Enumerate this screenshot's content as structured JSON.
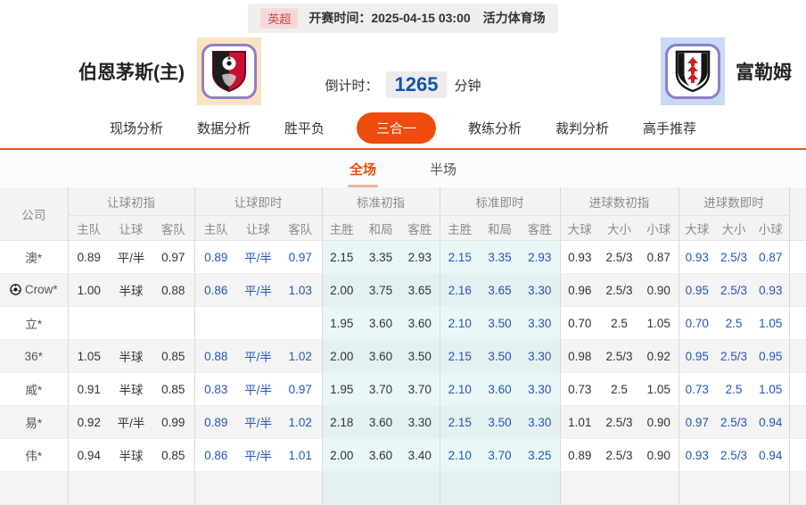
{
  "colors": {
    "accent_orange": "#ee4b0c",
    "nav_border_orange": "#e8552a",
    "blue_odds": "#2357b5",
    "league_red": "#d94141",
    "countdown_blue": "#1553ae",
    "cyan_column_bg": "#e9f7f7",
    "home_badge_bg": "#fbe3c1",
    "away_badge_bg": "#c9d9f6",
    "badge_border_purple": "#8f7fc4"
  },
  "match_bar": {
    "league": "英超",
    "kickoff_label": "开赛时间：",
    "kickoff_time": "2025-04-15 03:00",
    "venue": "活力体育场"
  },
  "teams": {
    "home": {
      "name": "伯恩茅斯(主)",
      "badge_icon": "bournemouth-crest"
    },
    "away": {
      "name": "富勒姆",
      "badge_icon": "fulham-crest"
    }
  },
  "countdown": {
    "label": "倒计时：",
    "value": "1265",
    "unit": "分钟"
  },
  "nav": {
    "items": [
      {
        "label": "现场分析",
        "active": false
      },
      {
        "label": "数据分析",
        "active": false
      },
      {
        "label": "胜平负",
        "active": false
      },
      {
        "label": "三合一",
        "active": true
      },
      {
        "label": "教练分析",
        "active": false
      },
      {
        "label": "裁判分析",
        "active": false
      },
      {
        "label": "高手推荐",
        "active": false
      }
    ]
  },
  "subtabs": {
    "items": [
      {
        "label": "全场",
        "active": true
      },
      {
        "label": "半场",
        "active": false
      }
    ]
  },
  "table": {
    "company_header": "公司",
    "groups": [
      {
        "label": "让球初指",
        "cols": [
          "主队",
          "让球",
          "客队"
        ],
        "blue": false,
        "cyan": false
      },
      {
        "label": "让球即时",
        "cols": [
          "主队",
          "让球",
          "客队"
        ],
        "blue": true,
        "cyan": false
      },
      {
        "label": "标准初指",
        "cols": [
          "主胜",
          "和局",
          "客胜"
        ],
        "blue": false,
        "cyan": true
      },
      {
        "label": "标准即时",
        "cols": [
          "主胜",
          "和局",
          "客胜"
        ],
        "blue": true,
        "cyan": true
      },
      {
        "label": "进球数初指",
        "cols": [
          "大球",
          "大小",
          "小球"
        ],
        "blue": false,
        "cyan": false
      },
      {
        "label": "进球数即时",
        "cols": [
          "大球",
          "大小",
          "小球"
        ],
        "blue": true,
        "cyan": false
      }
    ],
    "rows": [
      {
        "company": "澳*",
        "icon": false,
        "values": [
          [
            "0.89",
            "平/半",
            "0.97"
          ],
          [
            "0.89",
            "平/半",
            "0.97"
          ],
          [
            "2.15",
            "3.35",
            "2.93"
          ],
          [
            "2.15",
            "3.35",
            "2.93"
          ],
          [
            "0.93",
            "2.5/3",
            "0.87"
          ],
          [
            "0.93",
            "2.5/3",
            "0.87"
          ]
        ]
      },
      {
        "company": "Crow*",
        "icon": true,
        "values": [
          [
            "1.00",
            "半球",
            "0.88"
          ],
          [
            "0.86",
            "平/半",
            "1.03"
          ],
          [
            "2.00",
            "3.75",
            "3.65"
          ],
          [
            "2.16",
            "3.65",
            "3.30"
          ],
          [
            "0.96",
            "2.5/3",
            "0.90"
          ],
          [
            "0.95",
            "2.5/3",
            "0.93"
          ]
        ]
      },
      {
        "company": "立*",
        "icon": false,
        "values": [
          [
            "",
            "",
            ""
          ],
          [
            "",
            "",
            ""
          ],
          [
            "1.95",
            "3.60",
            "3.60"
          ],
          [
            "2.10",
            "3.50",
            "3.30"
          ],
          [
            "0.70",
            "2.5",
            "1.05"
          ],
          [
            "0.70",
            "2.5",
            "1.05"
          ]
        ]
      },
      {
        "company": "36*",
        "icon": false,
        "values": [
          [
            "1.05",
            "半球",
            "0.85"
          ],
          [
            "0.88",
            "平/半",
            "1.02"
          ],
          [
            "2.00",
            "3.60",
            "3.50"
          ],
          [
            "2.15",
            "3.50",
            "3.30"
          ],
          [
            "0.98",
            "2.5/3",
            "0.92"
          ],
          [
            "0.95",
            "2.5/3",
            "0.95"
          ]
        ]
      },
      {
        "company": "威*",
        "icon": false,
        "values": [
          [
            "0.91",
            "半球",
            "0.85"
          ],
          [
            "0.83",
            "平/半",
            "0.97"
          ],
          [
            "1.95",
            "3.70",
            "3.70"
          ],
          [
            "2.10",
            "3.60",
            "3.30"
          ],
          [
            "0.73",
            "2.5",
            "1.05"
          ],
          [
            "0.73",
            "2.5",
            "1.05"
          ]
        ]
      },
      {
        "company": "易*",
        "icon": false,
        "values": [
          [
            "0.92",
            "平/半",
            "0.99"
          ],
          [
            "0.89",
            "平/半",
            "1.02"
          ],
          [
            "2.18",
            "3.60",
            "3.30"
          ],
          [
            "2.15",
            "3.50",
            "3.30"
          ],
          [
            "1.01",
            "2.5/3",
            "0.90"
          ],
          [
            "0.97",
            "2.5/3",
            "0.94"
          ]
        ]
      },
      {
        "company": "伟*",
        "icon": false,
        "values": [
          [
            "0.94",
            "半球",
            "0.85"
          ],
          [
            "0.86",
            "平/半",
            "1.01"
          ],
          [
            "2.00",
            "3.60",
            "3.40"
          ],
          [
            "2.10",
            "3.70",
            "3.25"
          ],
          [
            "0.89",
            "2.5/3",
            "0.90"
          ],
          [
            "0.93",
            "2.5/3",
            "0.94"
          ]
        ]
      }
    ]
  }
}
